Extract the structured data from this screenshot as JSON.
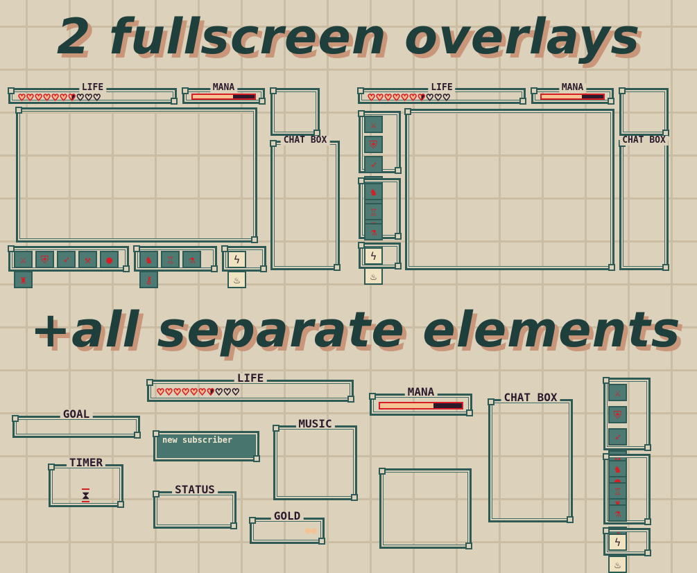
{
  "headings": {
    "top": "2 fullscreen overlays",
    "bottom": "+all separate elements"
  },
  "labels": {
    "life": "LIFE",
    "mana": "MANA",
    "chat": "CHAT BOX",
    "goal": "GOAL",
    "timer": "TIMER",
    "status": "STATUS",
    "music": "MUSIC",
    "gold": "GOLD",
    "new_subscriber": "new subscriber"
  },
  "life": {
    "total": 10,
    "filled": 6.5
  },
  "mana": {
    "percent": 65
  },
  "colors": {
    "background": "#dcd1bb",
    "frame": "#2d5a55",
    "heading": "#1f3f3c",
    "heading_shadow": "#c9967a",
    "heart": "#d81c24",
    "mana_fill": "#f6c394"
  },
  "icons": {
    "weapons": [
      {
        "name": "sword-icon",
        "glyph": "⚔"
      },
      {
        "name": "shield-icon",
        "glyph": "⛨"
      },
      {
        "name": "bow-icon",
        "glyph": "➶"
      },
      {
        "name": "axe-icon",
        "glyph": "⚒"
      },
      {
        "name": "bomb-icon",
        "glyph": "●"
      },
      {
        "name": "lantern-icon",
        "glyph": "♜"
      }
    ],
    "items": [
      {
        "name": "helmet-icon",
        "glyph": "♞"
      },
      {
        "name": "armor-icon",
        "glyph": "♖"
      },
      {
        "name": "potion-icon",
        "glyph": "⚗"
      },
      {
        "name": "key-icon",
        "glyph": "⚷"
      }
    ],
    "scrolls": [
      {
        "name": "lightning-scroll-icon",
        "glyph": "ϟ"
      },
      {
        "name": "fire-scroll-icon",
        "glyph": "♨"
      }
    ]
  },
  "timer_icon": "hourglass-icon",
  "gold_icon": "coins-icon"
}
